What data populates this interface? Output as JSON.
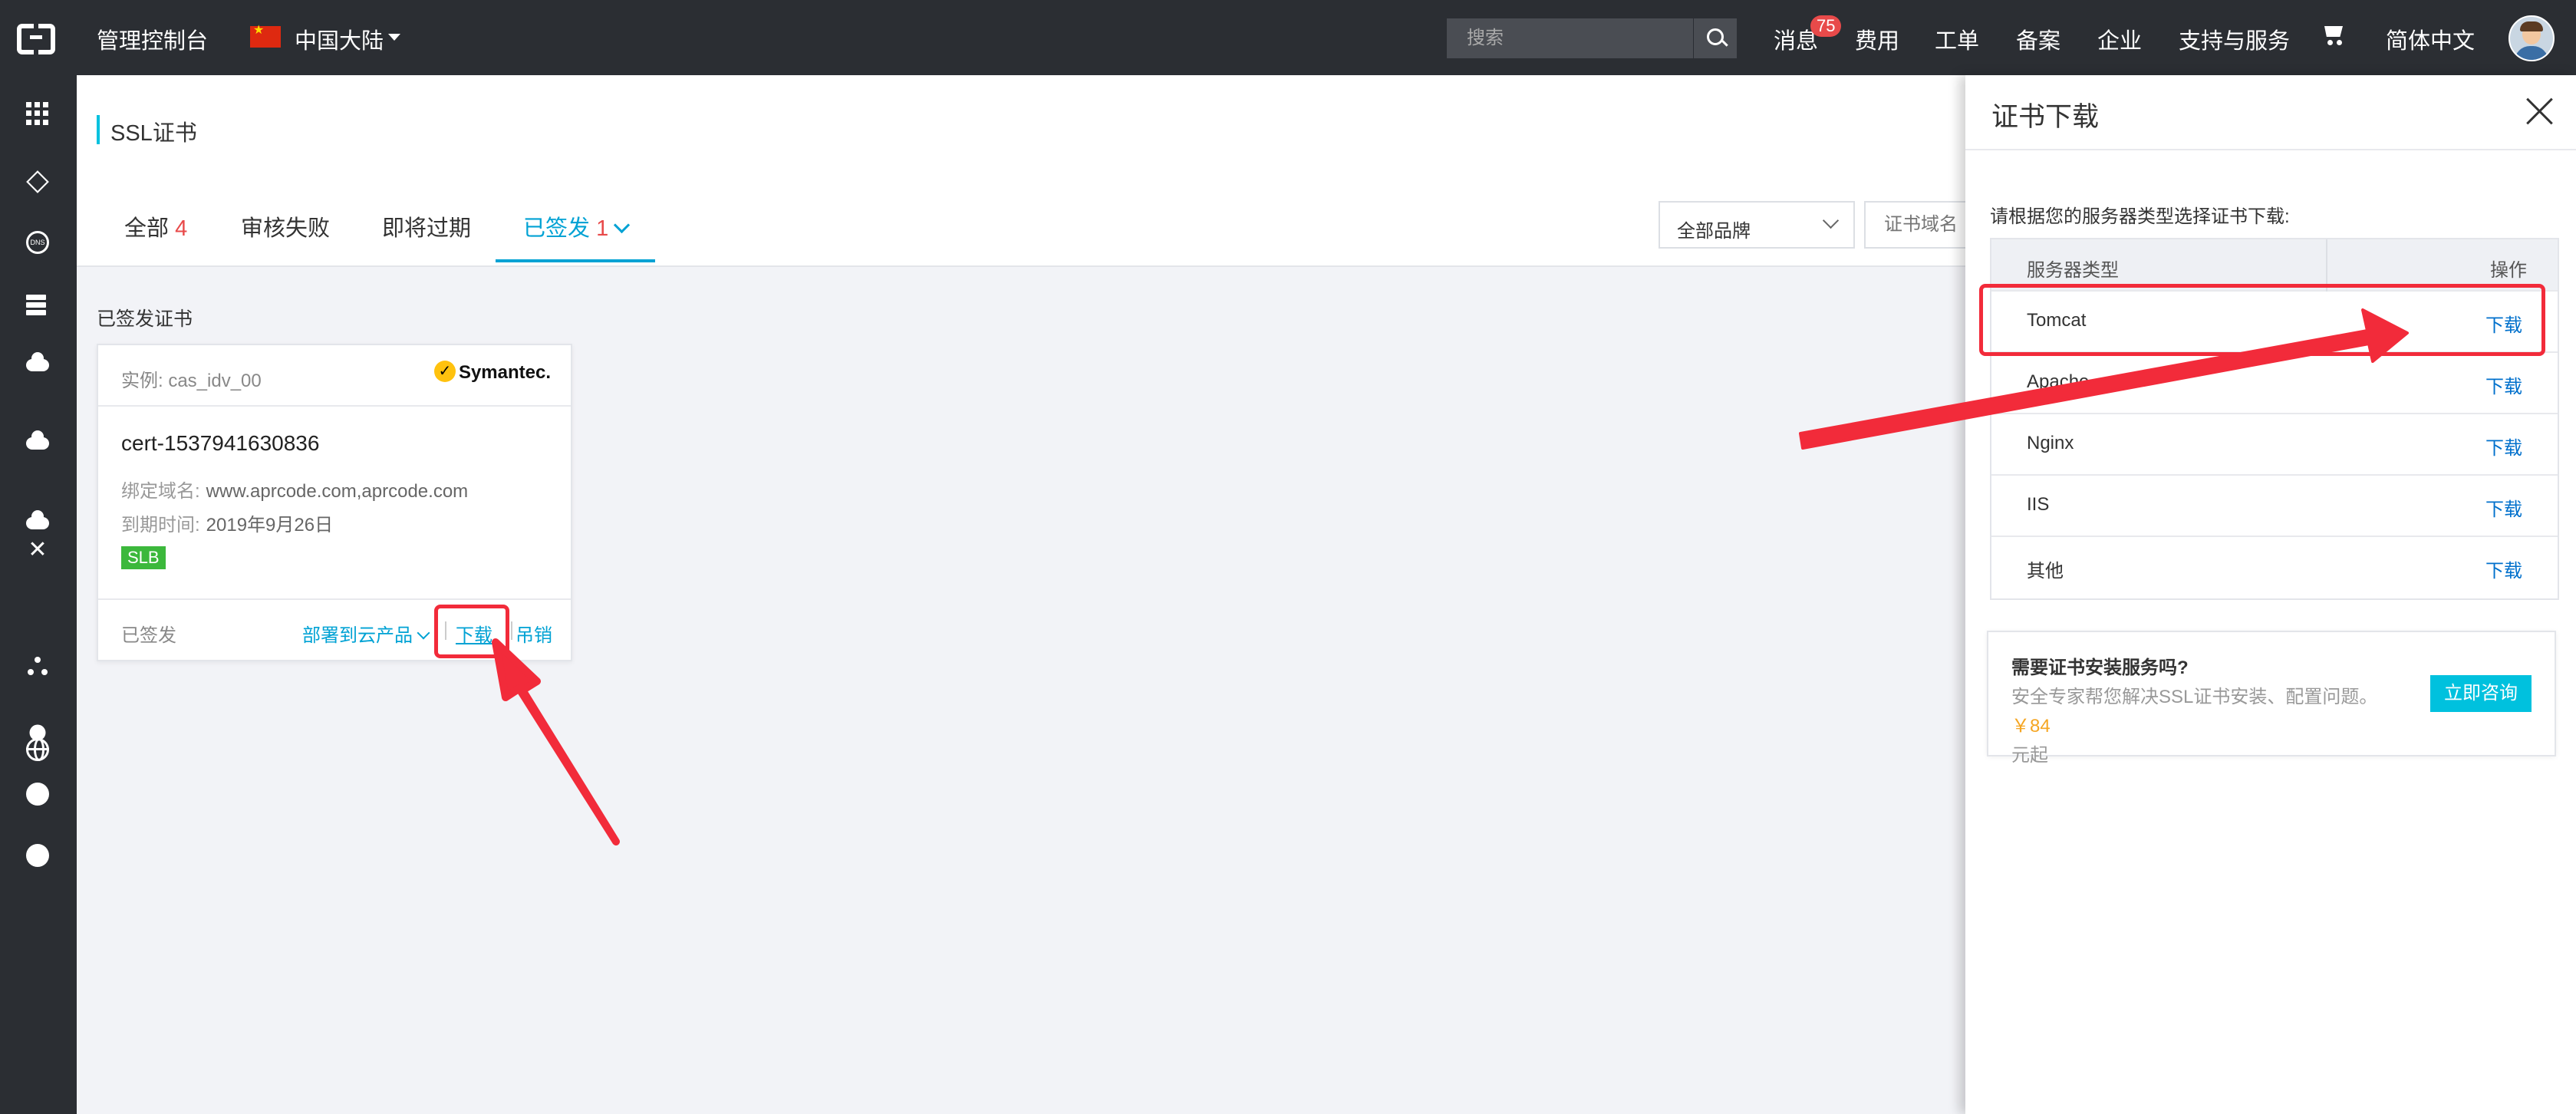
{
  "topbar": {
    "console": "管理控制台",
    "region": "中国大陆",
    "search_placeholder": "搜索",
    "nav": [
      "消息",
      "费用",
      "工单",
      "备案",
      "企业",
      "支持与服务"
    ],
    "message_badge": "75",
    "language": "简体中文"
  },
  "leftnav": {
    "icons": [
      "apps-grid-icon",
      "cube-icon",
      "dns-icon",
      "server-stack-icon",
      "cluster-icon",
      "cloud-icon",
      "cloud-upload-icon",
      "network-icon",
      "nodes-icon",
      "globe-icon",
      "settings-icon",
      "circle-icon",
      "circle-icon"
    ]
  },
  "page": {
    "title": "SSL证书",
    "tabs": [
      {
        "label": "全部",
        "count": "4"
      },
      {
        "label": "审核失败",
        "count": ""
      },
      {
        "label": "即将过期",
        "count": ""
      },
      {
        "label": "已签发",
        "count": "1"
      }
    ],
    "active_tab": 3,
    "brand_filter": "全部品牌",
    "domain_placeholder": "证书域名",
    "section_label": "已签发证书"
  },
  "cert_card": {
    "instance": "实例: cas_idv_00",
    "brand": "Symantec.",
    "name": "cert-1537941630836",
    "domain_label": "绑定域名:",
    "domain_value": "www.aprcode.com,aprcode.com",
    "expire_label": "到期时间:",
    "expire_value": "2019年9月26日",
    "tag": "SLB",
    "status": "已签发",
    "deploy": "部署到云产品",
    "download": "下载",
    "revoke": "吊销"
  },
  "drawer": {
    "title": "证书下载",
    "hint": "请根据您的服务器类型选择证书下载:",
    "col_server": "服务器类型",
    "col_action": "操作",
    "rows": [
      {
        "server": "Tomcat",
        "action": "下载"
      },
      {
        "server": "Apache",
        "action": "下载"
      },
      {
        "server": "Nginx",
        "action": "下载"
      },
      {
        "server": "IIS",
        "action": "下载"
      },
      {
        "server": "其他",
        "action": "下载"
      }
    ],
    "promo_title": "需要证书安装服务吗?",
    "promo_desc": "安全专家帮您解决SSL证书安装、配置问题。",
    "promo_price": "￥84",
    "promo_suffix": "元起",
    "promo_button": "立即咨询"
  },
  "colors": {
    "topbar": "#2b2e33",
    "accent": "#00c1de",
    "link": "#0070cc",
    "tab_active": "#00a2d4",
    "count": "#e84a4a",
    "annotation": "#f22b3a",
    "price": "#f5a623",
    "tag": "#3cb83c"
  }
}
